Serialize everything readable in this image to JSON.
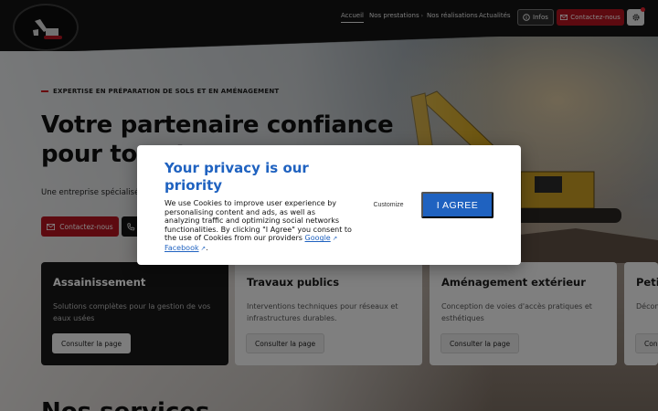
{
  "header": {
    "nav": [
      {
        "label": "Accueil"
      },
      {
        "label": "Nos prestations"
      },
      {
        "label": "Nos réalisations"
      },
      {
        "label": "Actualités"
      }
    ],
    "infos_label": "Infos",
    "contact_label": "Contactez-nous"
  },
  "hero": {
    "eyebrow": "EXPERTISE EN PRÉPARATION DE SOLS ET EN AMÉNAGEMENT",
    "title": "Votre partenaire confiance pour tous travaux",
    "description": "Une entreprise spécialisée dans les travaux publics intervenant",
    "contact_label": "Contactez-nous"
  },
  "cards": [
    {
      "title": "Assainissement",
      "text": "Solutions complètes pour la gestion de vos eaux usées",
      "cta": "Consulter la page"
    },
    {
      "title": "Travaux publics",
      "text": "Interventions techniques pour réseaux et infrastructures durables.",
      "cta": "Consulter la page"
    },
    {
      "title": "Aménagement extérieur",
      "text": "Conception de voies d'accès pratiques et esthétiques",
      "cta": "Consulter la page"
    },
    {
      "title": "Petit",
      "text": "Décon ouvrag",
      "cta": "Cons"
    }
  ],
  "section_title": "Nos services",
  "cookie": {
    "title": "Your privacy is our priority",
    "body": "We use Cookies to improve user experience by personalising content and ads, as well as analyzing traffic and optimizing social networks functionalities. By clicking \"I Agree\" you consent to the use of Cookies from our providers",
    "links": [
      "Google",
      "Facebook"
    ],
    "customize_label": "Customize",
    "agree_label": "I AGREE"
  },
  "colors": {
    "brand_red": "#b3141f",
    "cookie_blue": "#1f62c0",
    "header_bg": "#141414"
  }
}
